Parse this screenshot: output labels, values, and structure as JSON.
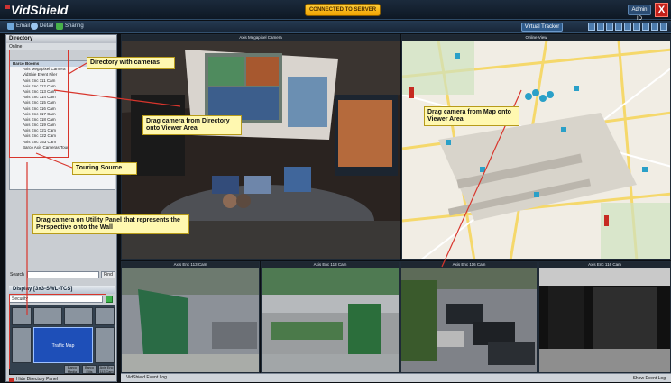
{
  "app": {
    "name": "VidShield",
    "top_button": "CONNECTED TO SERVER",
    "admin": "Admin ID"
  },
  "toolbar": {
    "email": "Email",
    "detail": "Detail",
    "sharing": "Sharing",
    "virtual_tracker": "Virtual Tracker"
  },
  "directory": {
    "title": "Directory",
    "online_label": "Online",
    "site": "Barco Booms",
    "items": [
      "Axis Megapixel Camera",
      "VidShie Event Filer",
      "Axis Enc 111 Cam",
      "Axis Enc 112 Cam",
      "Axis Enc 113 Cam",
      "Axis Enc 114 Cam",
      "Axis Enc 115 Cam",
      "Axis Enc 116 Cam",
      "Axis Enc 117 Cam",
      "Axis Enc 118 Cam",
      "Axis Enc 119 Cam",
      "Axis Enc 121 Cam",
      "Axis Enc 122 Cam",
      "Axis Enc 153 Cam",
      "Barco Axis Cameras Tour"
    ],
    "search_label": "Search",
    "find_label": "Find"
  },
  "display": {
    "title": "Display [3x3-SWL-TCS]",
    "layout": "Security",
    "traffic": "Traffic Map",
    "cells": [
      "",
      "",
      "",
      "",
      "",
      "",
      "Barco Media",
      "Barco Ellis",
      "Axis Enc 113 Cam"
    ]
  },
  "hide_panel": "Hide Directory Panel",
  "panes": {
    "main": "Axis Megapixel Camera",
    "map": "Online View",
    "cams": [
      "Axis Enc 113 Cam",
      "Axis Enc 113 Cam",
      "Axis Enc 116 Cam",
      "Axis Enc 116 Cam"
    ]
  },
  "annotations": {
    "dir_cameras": "Directory with cameras",
    "drag_dir": "Drag camera from Directory onto Viewer Area",
    "drag_map": "Drag camera from Map onto Viewer Area",
    "touring": "Touring Source",
    "drag_utility": "Drag camera on Utility Panel that represents the Perspective onto the Wall"
  },
  "bottom": {
    "log": "VidShield Event Log",
    "show": "Show Event Log"
  }
}
